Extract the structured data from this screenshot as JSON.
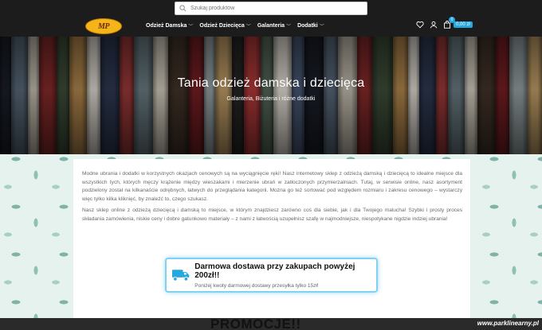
{
  "search": {
    "placeholder": "Szukaj produktów"
  },
  "logo": {
    "text": "MP"
  },
  "nav": {
    "items": [
      {
        "label": "Odzież Damska"
      },
      {
        "label": "Odzież Dziecięca"
      },
      {
        "label": "Galanteria"
      },
      {
        "label": "Dodatki"
      }
    ]
  },
  "cart": {
    "count": "0",
    "amount": "0,00 zł"
  },
  "hero": {
    "title": "Tania odzież damska i dziecięca",
    "subtitle": "Galanteria, Biżuteria i różne dodatki"
  },
  "intro": {
    "p1": "Modne ubrania i dodatki w korzystnych okazjach cenowych są na wyciągnięcie ręki! Nasz internetowy sklep z odzieżą damską i dziecięcą to idealne miejsce dla wszystkich tych, których męczy krążenie między wieszakami i mierzenie ubrań w zatłoczonych przymierzalniach. Tutaj, w serwisie online, nasz asortyment podzielony został na kilkanaście odrębnych, łatwych do przeglądania kategorii. Można go też sortować pod względem rozmiaru i zakresu cenowego – wystarczy więc tylko kilka kliknięć, by znaleźć to, czego szukasz.",
    "p2": "Nasz sklep online z odzieżą dziecięcą i damską to miejsce, w którym znajdziesz zarówno coś dla siebie, jak i dla Twojego malucha! Szybki i prosty proces składania zamówienia, niskie ceny i dobre gatunkowo materiały – z nami z łatwością uzupełnisz szafę w najmodniejsze, niespotykane nigdzie indziej ubrania!"
  },
  "shipping": {
    "title": "Darmowa dostawa przy zakupach powyżej 200zł!!",
    "subtitle": "Poniżej kwoty darmowej dostawy przesyłka tylko 15zł!"
  },
  "promo": {
    "heading": "PROMOCJE!!"
  },
  "watermark": {
    "text": "www.parklinearny.pl"
  },
  "colors": {
    "accent": "#23a8e0",
    "header_bg": "#1c1c1c",
    "logo": "#f4b41a"
  }
}
